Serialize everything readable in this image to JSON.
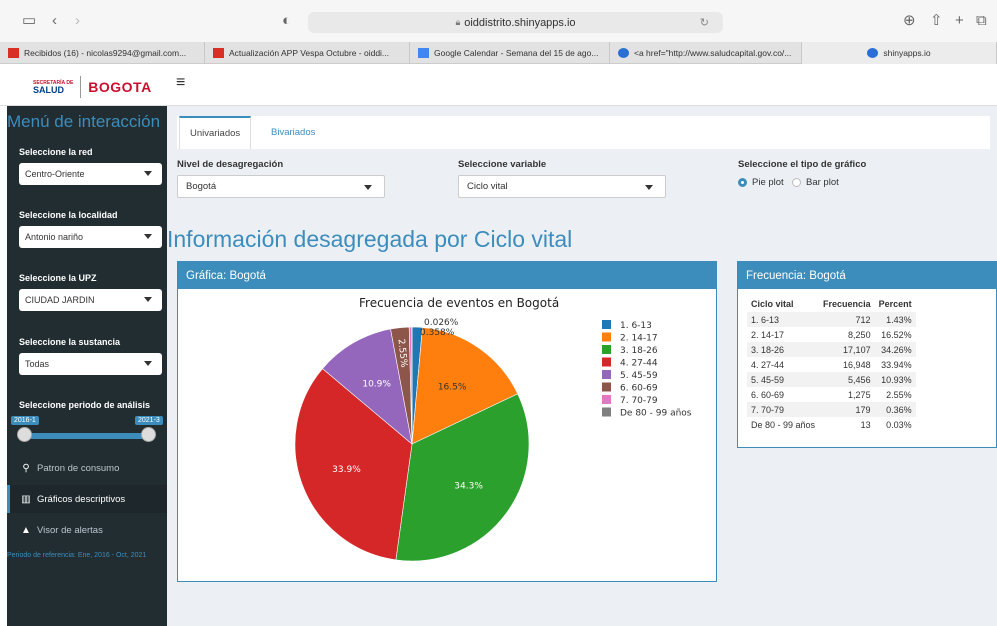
{
  "browser": {
    "url": "oiddistrito.shinyapps.io",
    "tabs": [
      {
        "label": "Recibidos (16) - nicolas9294@gmail.com...",
        "favicon_color": "#d93025"
      },
      {
        "label": "Actualización APP Vespa Octubre - oiddi...",
        "favicon_color": "#d93025"
      },
      {
        "label": "Google Calendar - Semana del 15 de ago...",
        "favicon_color": "#4285f4"
      },
      {
        "label": "<a href=\"http://www.saludcapital.gov.co/...",
        "favicon_color": "#2a6fd6"
      },
      {
        "label": "shinyapps.io",
        "favicon_color": "#2a6fd6"
      }
    ]
  },
  "logo": {
    "secretaria": "SECRETARÍA DE",
    "salud": "SALUD",
    "bogota": "BOGOTA"
  },
  "sidebar": {
    "title": "Menú de interacción",
    "red": {
      "label": "Seleccione la red",
      "value": "Centro-Oriente"
    },
    "localidad": {
      "label": "Seleccione la localidad",
      "value": "Antonio nariño"
    },
    "upz": {
      "label": "Seleccione la UPZ",
      "value": "CIUDAD JARDIN"
    },
    "sustancia": {
      "label": "Seleccione la sustancia",
      "value": "Todas"
    },
    "periodo": {
      "label": "Seleccione periodo de análisis",
      "from": "2016-1",
      "to": "2021-3"
    },
    "menu": [
      {
        "label": "Patron de consumo",
        "icon": "search-icon"
      },
      {
        "label": "Gráficos descriptivos",
        "icon": "bar-chart-icon"
      },
      {
        "label": "Visor de alertas",
        "icon": "warning-icon"
      }
    ],
    "reference": "Periodo de referencia: Ene, 2016 - Oct, 2021"
  },
  "main": {
    "tabs": [
      "Univariados",
      "Bivariados"
    ],
    "nivel": {
      "label": "Nivel de desagregación",
      "value": "Bogotá"
    },
    "variable": {
      "label": "Seleccione variable",
      "value": "Ciclo vital"
    },
    "tipo": {
      "label": "Seleccione el tipo de gráfico",
      "options": [
        "Pie plot",
        "Bar plot"
      ],
      "selected": "Pie plot"
    },
    "heading": "Información desagregada por Ciclo vital",
    "chart_box_title": "Gráfica: Bogotá",
    "table_box_title": "Frecuencia: Bogotá"
  },
  "table": {
    "headers": [
      "Ciclo vital",
      "Frecuencia",
      "Percent"
    ],
    "rows": [
      [
        "1. 6-13",
        "712",
        "1.43%"
      ],
      [
        "2. 14-17",
        "8,250",
        "16.52%"
      ],
      [
        "3. 18-26",
        "17,107",
        "34.26%"
      ],
      [
        "4. 27-44",
        "16,948",
        "33.94%"
      ],
      [
        "5. 45-59",
        "5,456",
        "10.93%"
      ],
      [
        "6. 60-69",
        "1,275",
        "2.55%"
      ],
      [
        "7. 70-79",
        "179",
        "0.36%"
      ],
      [
        "De 80 - 99 años",
        "13",
        "0.03%"
      ]
    ]
  },
  "colors": {
    "accent": "#3c8dbc",
    "sidebar": "#222d32"
  },
  "chart_data": {
    "type": "pie",
    "title": "Frecuencia de eventos en Bogotá",
    "categories": [
      "1. 6-13",
      "2. 14-17",
      "3. 18-26",
      "4. 27-44",
      "5. 45-59",
      "6. 60-69",
      "7. 70-79",
      "De 80 - 99 años"
    ],
    "values": [
      712,
      8250,
      17107,
      16948,
      5456,
      1275,
      179,
      13
    ],
    "slice_labels": [
      "",
      "16.5%",
      "34.3%",
      "33.9%",
      "10.9%",
      "2.55%",
      "0.358%",
      "0.026%"
    ],
    "colors": [
      "#1f77b4",
      "#ff7f0e",
      "#2ca02c",
      "#d62728",
      "#9467bd",
      "#8c564b",
      "#e377c2",
      "#7f7f7f"
    ],
    "legend_position": "right",
    "direction": "clockwise"
  }
}
